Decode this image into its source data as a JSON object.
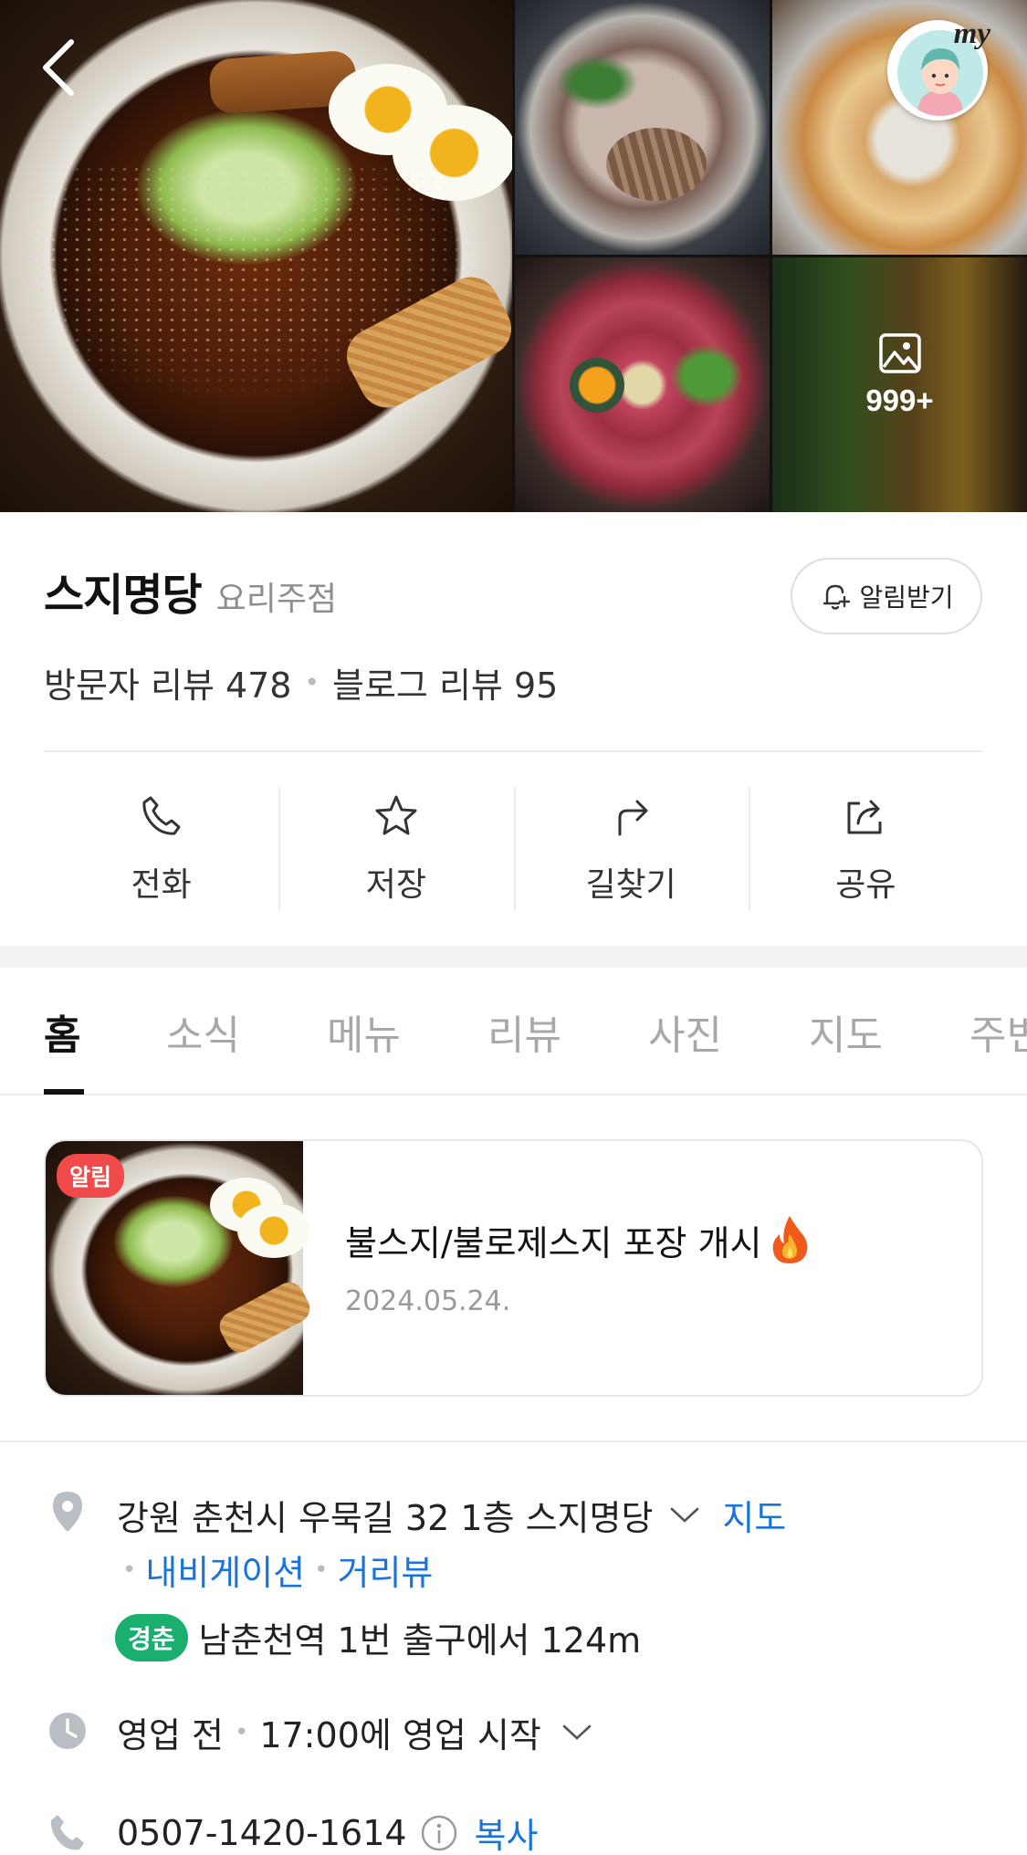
{
  "header": {
    "photo_count": "999+",
    "avatar_label": "my"
  },
  "place": {
    "name": "스지명당",
    "category": "요리주점",
    "notify_label": "알림받기",
    "visitor_reviews_label": "방문자 리뷰 478",
    "blog_reviews_label": "블로그 리뷰 95"
  },
  "actions": [
    {
      "label": "전화",
      "icon": "phone-icon"
    },
    {
      "label": "저장",
      "icon": "star-icon"
    },
    {
      "label": "길찾기",
      "icon": "directions-icon"
    },
    {
      "label": "공유",
      "icon": "share-icon"
    }
  ],
  "tabs": [
    {
      "label": "홈",
      "active": true
    },
    {
      "label": "소식"
    },
    {
      "label": "메뉴"
    },
    {
      "label": "리뷰"
    },
    {
      "label": "사진"
    },
    {
      "label": "지도"
    },
    {
      "label": "주변"
    }
  ],
  "news": {
    "badge": "알림",
    "title": "불스지/불로제스지 포장 개시",
    "date": "2024.05.24."
  },
  "info": {
    "address": "강원 춘천시 우묵길 32 1층 스지명당",
    "map_link": "지도",
    "navigation_link": "내비게이션",
    "street_view_link": "거리뷰",
    "subway_line": "경춘",
    "subway_text": "남춘천역 1번 출구에서 124m",
    "hours_status": "영업 전",
    "hours_text": "17:00에 영업 시작",
    "phone": "0507-1420-1614",
    "copy_label": "복사"
  },
  "colors": {
    "link": "#1874d8",
    "badge_red": "#f04a4a",
    "subway_green": "#1aae6f"
  }
}
